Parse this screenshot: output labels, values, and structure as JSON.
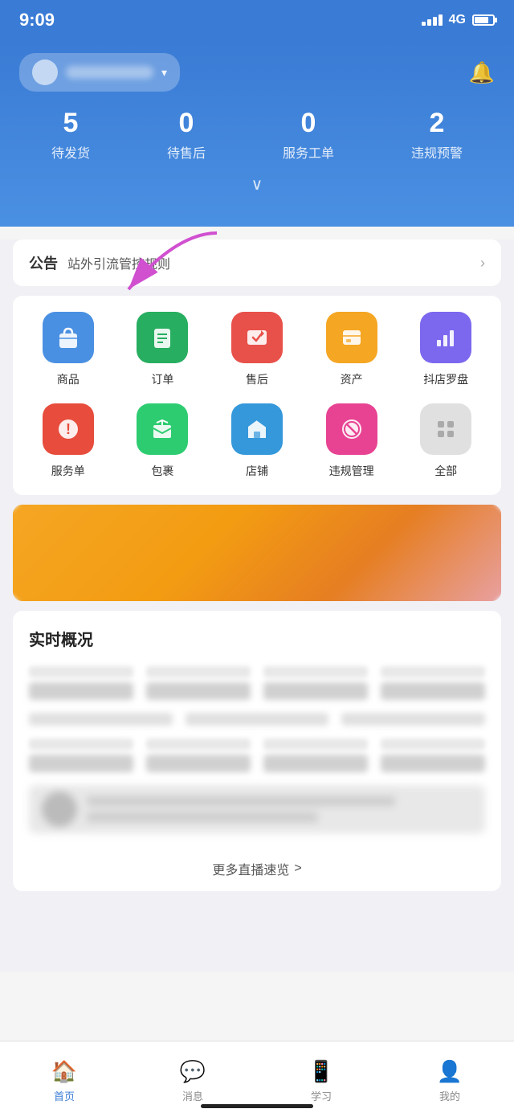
{
  "status_bar": {
    "time": "9:09",
    "network": "4G"
  },
  "header": {
    "store_name_placeholder": "店铺名称",
    "bell_label": "通知"
  },
  "stats": [
    {
      "number": "5",
      "label": "待发货"
    },
    {
      "number": "0",
      "label": "待售后"
    },
    {
      "number": "0",
      "label": "服务工单"
    },
    {
      "number": "2",
      "label": "违规预警"
    }
  ],
  "announcement": {
    "tag": "公告",
    "text": "站外引流管控规则"
  },
  "menu_items": [
    {
      "label": "商品",
      "icon_color": "blue",
      "icon_char": "🛍️"
    },
    {
      "label": "订单",
      "icon_color": "green",
      "icon_char": "📋"
    },
    {
      "label": "售后",
      "icon_color": "pink",
      "icon_char": "↩"
    },
    {
      "label": "资产",
      "icon_color": "orange",
      "icon_char": "🗂️"
    },
    {
      "label": "抖店罗盘",
      "icon_color": "purple",
      "icon_char": "📊"
    },
    {
      "label": "服务单",
      "icon_color": "red",
      "icon_char": "❗"
    },
    {
      "label": "包裹",
      "icon_color": "green2",
      "icon_char": "📦"
    },
    {
      "label": "店铺",
      "icon_color": "blue2",
      "icon_char": "🏠"
    },
    {
      "label": "违规管理",
      "icon_color": "pinkred",
      "icon_char": "⊘"
    },
    {
      "label": "全部",
      "icon_color": "gray",
      "icon_char": "⊞"
    }
  ],
  "realtime": {
    "title": "实时概况"
  },
  "more_live": {
    "text": "更多直播速览",
    "arrow": ">"
  },
  "bottom_nav": [
    {
      "label": "首页",
      "icon": "🏠",
      "active": true
    },
    {
      "label": "消息",
      "icon": "💬",
      "active": false
    },
    {
      "label": "学习",
      "icon": "📱",
      "active": false
    },
    {
      "label": "我的",
      "icon": "👤",
      "active": false
    }
  ]
}
